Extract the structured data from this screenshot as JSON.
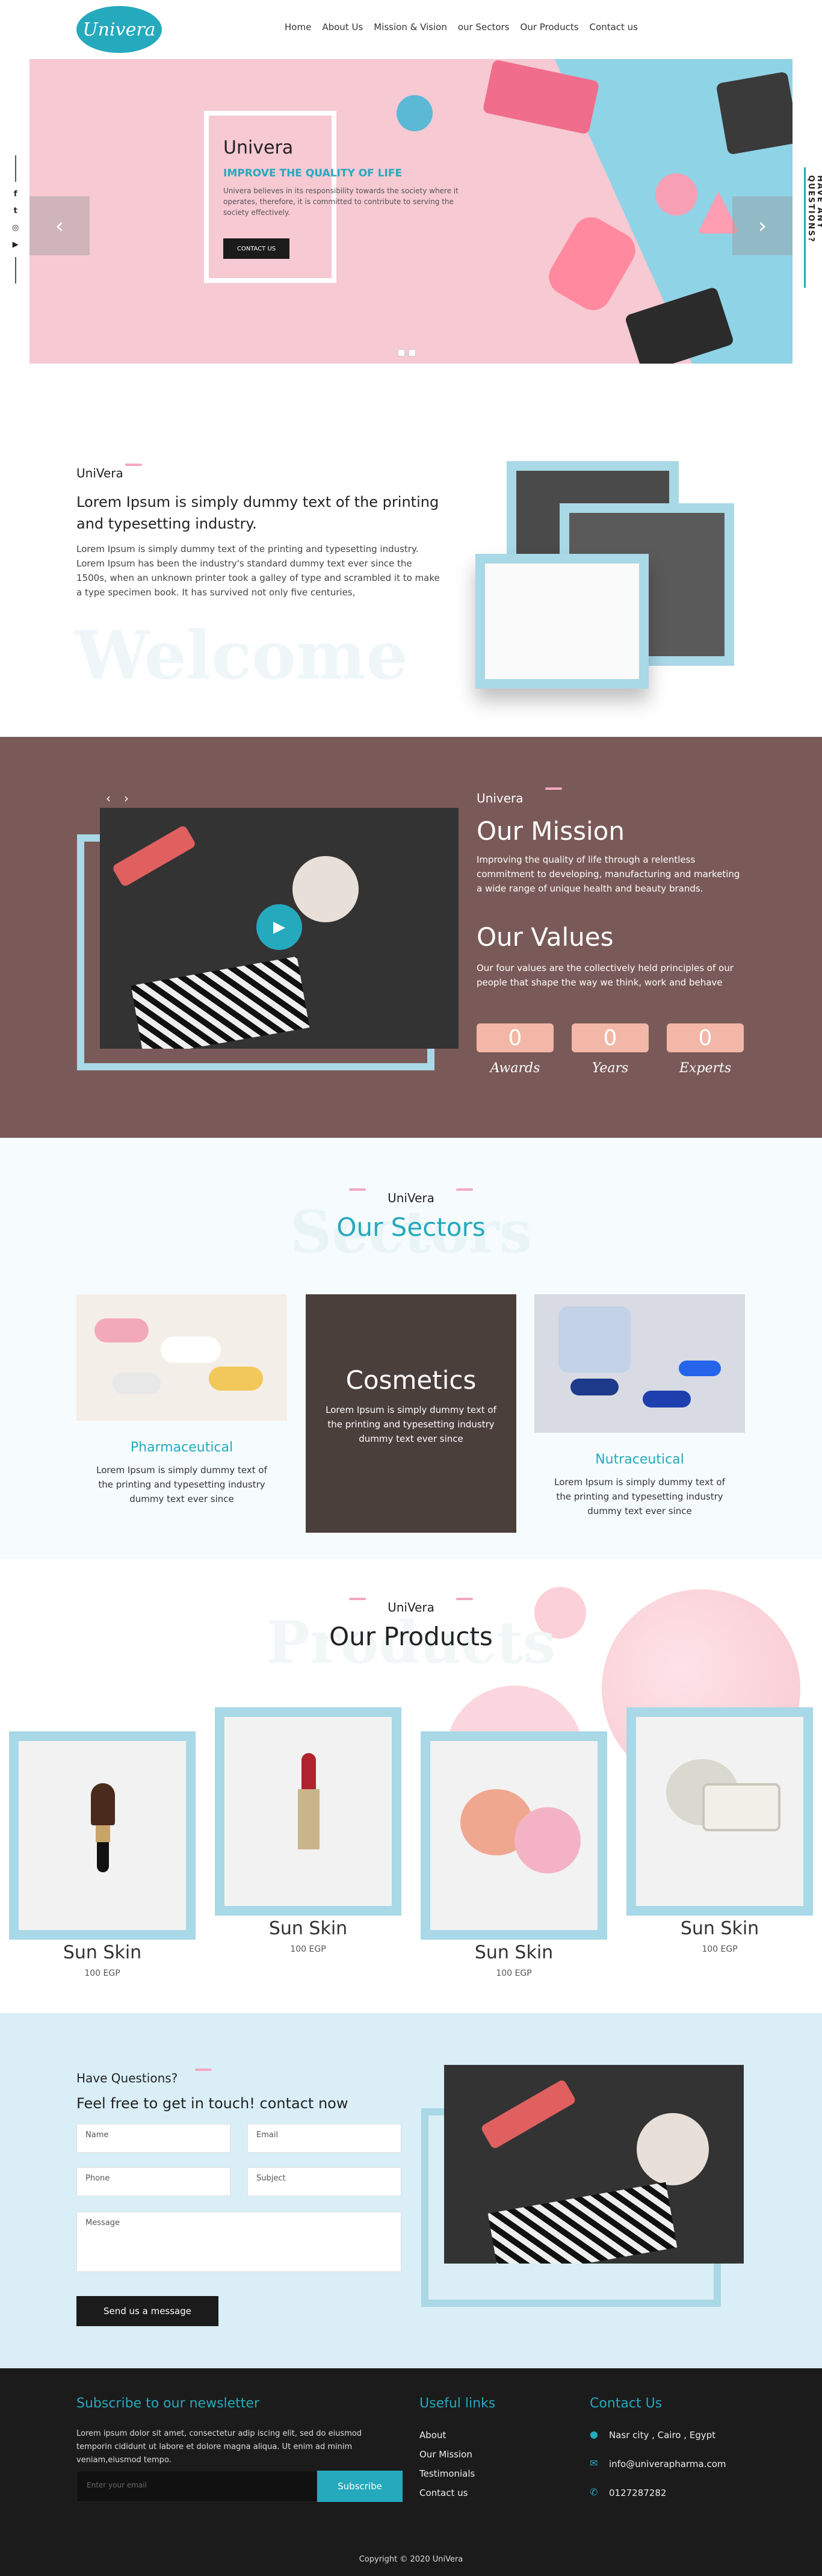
{
  "brand": {
    "logo": "Univera",
    "accent": "#25a9bd"
  },
  "nav": [
    "Home",
    "About Us",
    "Mission & Vision",
    "our Sectors",
    "Our Products",
    "Contact us"
  ],
  "hero": {
    "title": "Univera",
    "subtitle": "IMPROVE THE QUALITY OF LIFE",
    "text": "Univera believes in its responsibility towards the society where it operates, therefore, it is committed to contribute to serving the society effectively.",
    "button": "CONTACT US",
    "prev": "‹",
    "next": "›"
  },
  "social_icons": [
    "f",
    "t",
    "◎",
    "▶"
  ],
  "side_tab": "HAVE ANY QUESTIONS?",
  "welcome": {
    "label": "UniVera",
    "heading": "Lorem Ipsum is simply dummy text of the printing and typesetting industry.",
    "text": "Lorem Ipsum is simply dummy text of the printing and typesetting industry. Lorem Ipsum has been the industry's standard dummy text ever since the 1500s, when an unknown printer took a galley of type and scrambled it to make a type specimen book. It has survived not only five centuries,",
    "bg_word": "Welcome"
  },
  "mission": {
    "label": "Univera",
    "title": "Our Mission",
    "text": "Improving the quality of life through a relentless commitment to developing, manufacturing and marketing a wide range of unique health and beauty brands.",
    "values_title": "Our Values",
    "values_text": "Our four values are the collectively held principles of our people that shape the way we think, work and behave",
    "counters": [
      {
        "value": "0",
        "label": "Awards"
      },
      {
        "value": "0",
        "label": "Years"
      },
      {
        "value": "0",
        "label": "Experts"
      }
    ],
    "play": "▶"
  },
  "sectors": {
    "label": "UniVera",
    "bg_word": "Sectors",
    "title": "Our Sectors",
    "cards": [
      {
        "title": "Pharmaceutical",
        "text": "Lorem Ipsum is simply dummy text of the printing and typesetting industry dummy text ever since"
      },
      {
        "title": "Cosmetics",
        "text": "Lorem Ipsum is simply dummy text of the printing and typesetting industry dummy text ever since"
      },
      {
        "title": "Nutraceutical",
        "text": "Lorem Ipsum is simply dummy text of the printing and typesetting industry dummy text ever since"
      }
    ]
  },
  "products": {
    "label": "UniVera",
    "bg_word": "Products",
    "title": "Our Products",
    "items": [
      {
        "name": "Sun Skin",
        "price": "100 EGP"
      },
      {
        "name": "Sun Skin",
        "price": "100 EGP"
      },
      {
        "name": "Sun Skin",
        "price": "100 EGP"
      },
      {
        "name": "Sun Skin",
        "price": "100 EGP"
      }
    ]
  },
  "contact": {
    "label": "Have Questions?",
    "title": "Feel free to get in touch! contact now",
    "fields": {
      "name": "Name",
      "email": "Email",
      "phone": "Phone",
      "subject": "Subject",
      "message": "Message"
    },
    "button": "Send us a message"
  },
  "footer": {
    "newsletter_title": "Subscribe to our newsletter",
    "newsletter_text": "Lorem ipsum dolor sit amet, consectetur adip iscing elit, sed do eiusmod temporin cididunt ut labore et dolore magna aliqua. Ut enim ad minim veniam,eiusmod tempo.",
    "email_placeholder": "Enter your email",
    "subscribe": "Subscribe",
    "links_title": "Useful links",
    "links": [
      "About",
      "Our Mission",
      "Testimonials",
      "Contact us"
    ],
    "contact_title": "Contact Us",
    "address": "Nasr city , Cairo , Egypt",
    "email": "info@univerapharma.com",
    "phone": "0127287282",
    "copyright": "Copyright © 2020 UniVera"
  }
}
